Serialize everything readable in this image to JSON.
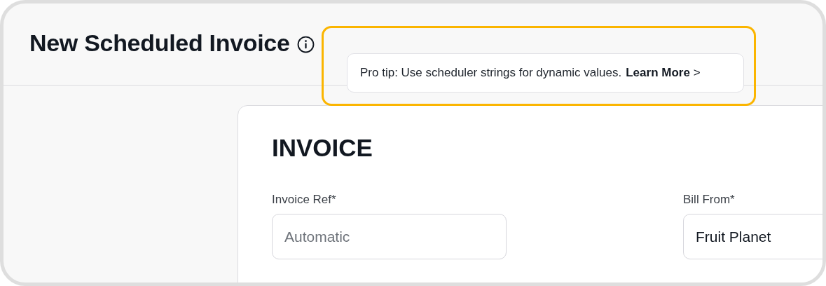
{
  "header": {
    "title": "New Scheduled Invoice"
  },
  "tooltip": {
    "text": "Pro tip: Use scheduler strings for dynamic values.",
    "link": "Learn More",
    "link_icon": ">"
  },
  "card": {
    "title": "INVOICE",
    "fields": [
      {
        "label": "Invoice Ref*",
        "placeholder": "Automatic"
      },
      {
        "label": "Bill From*",
        "value": "Fruit Planet"
      }
    ]
  }
}
